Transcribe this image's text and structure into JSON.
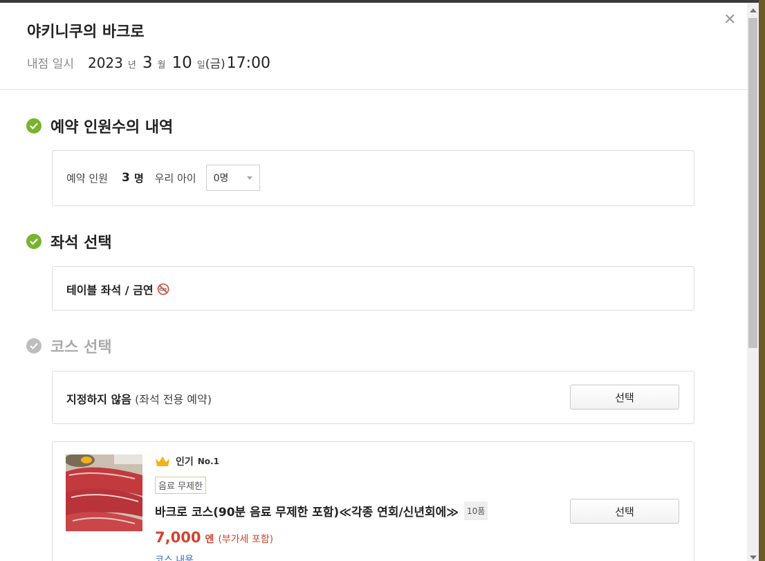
{
  "dialog": {
    "shop_name": "야키니쿠의 바크로",
    "visit_label": "내점 일시",
    "visit": {
      "year": "2023",
      "year_unit": "년",
      "month": "3",
      "month_unit": "월",
      "day": "10",
      "day_unit": "일",
      "weekday": "(금)",
      "time": "17:00"
    }
  },
  "people_section": {
    "title": "예약 인원수의 내역",
    "label": "예약 인원",
    "count": "3",
    "count_unit": "명",
    "child_label": "우리 아이",
    "child_select": "0명"
  },
  "seat_section": {
    "title": "좌석 선택",
    "seat": "테이블 좌석 / 금연"
  },
  "course_section": {
    "title": "코스 선택",
    "none_option": {
      "label": "지정하지 않음",
      "sub": "(좌석 전용 예약)",
      "button": "선택"
    },
    "course": {
      "popular_label": "인기",
      "rank": "No.1",
      "tag": "음료 무제한",
      "title": "바크로 코스(90분 음료 무제한 포함)≪각종 연회/신년회에≫",
      "items": "10품",
      "price": "7,000",
      "currency": "엔",
      "tax_note": "(부가세 포함)",
      "detail_link": "코스 내용",
      "button": "선택"
    }
  },
  "colors": {
    "check_active": "#7ab32e",
    "check_inactive": "#bdbdbd",
    "price": "#d2432f",
    "link": "#3a6fc4"
  },
  "icons": [
    "close-icon",
    "check-circle-icon",
    "no-smoking-icon",
    "crown-icon",
    "select-caret-icon"
  ]
}
